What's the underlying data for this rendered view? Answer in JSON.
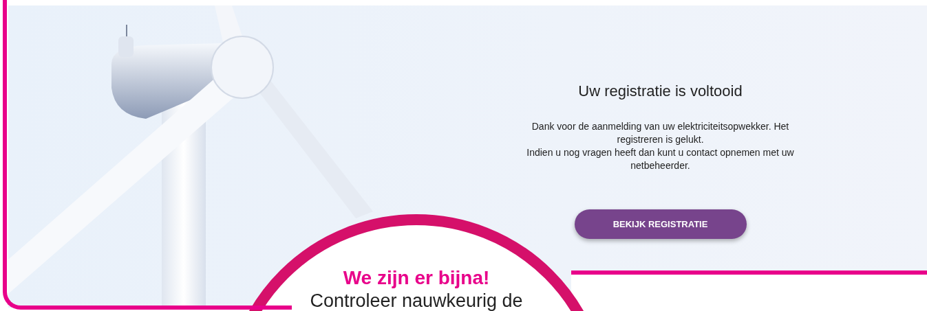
{
  "page": {
    "title": "Uw registratie is voltooid",
    "paragraphs": [
      "Dank voor de aanmelding van uw elektriciteitsopwekker. Het registreren is gelukt.",
      "Indien u nog vragen heeft dan kunt u contact opnemen met uw netbeheerder."
    ],
    "button": "BEKIJK REGISTRATIE"
  },
  "callout": {
    "heading": "We zijn er bijna!",
    "text": "Controleer nauwkeurig de"
  }
}
